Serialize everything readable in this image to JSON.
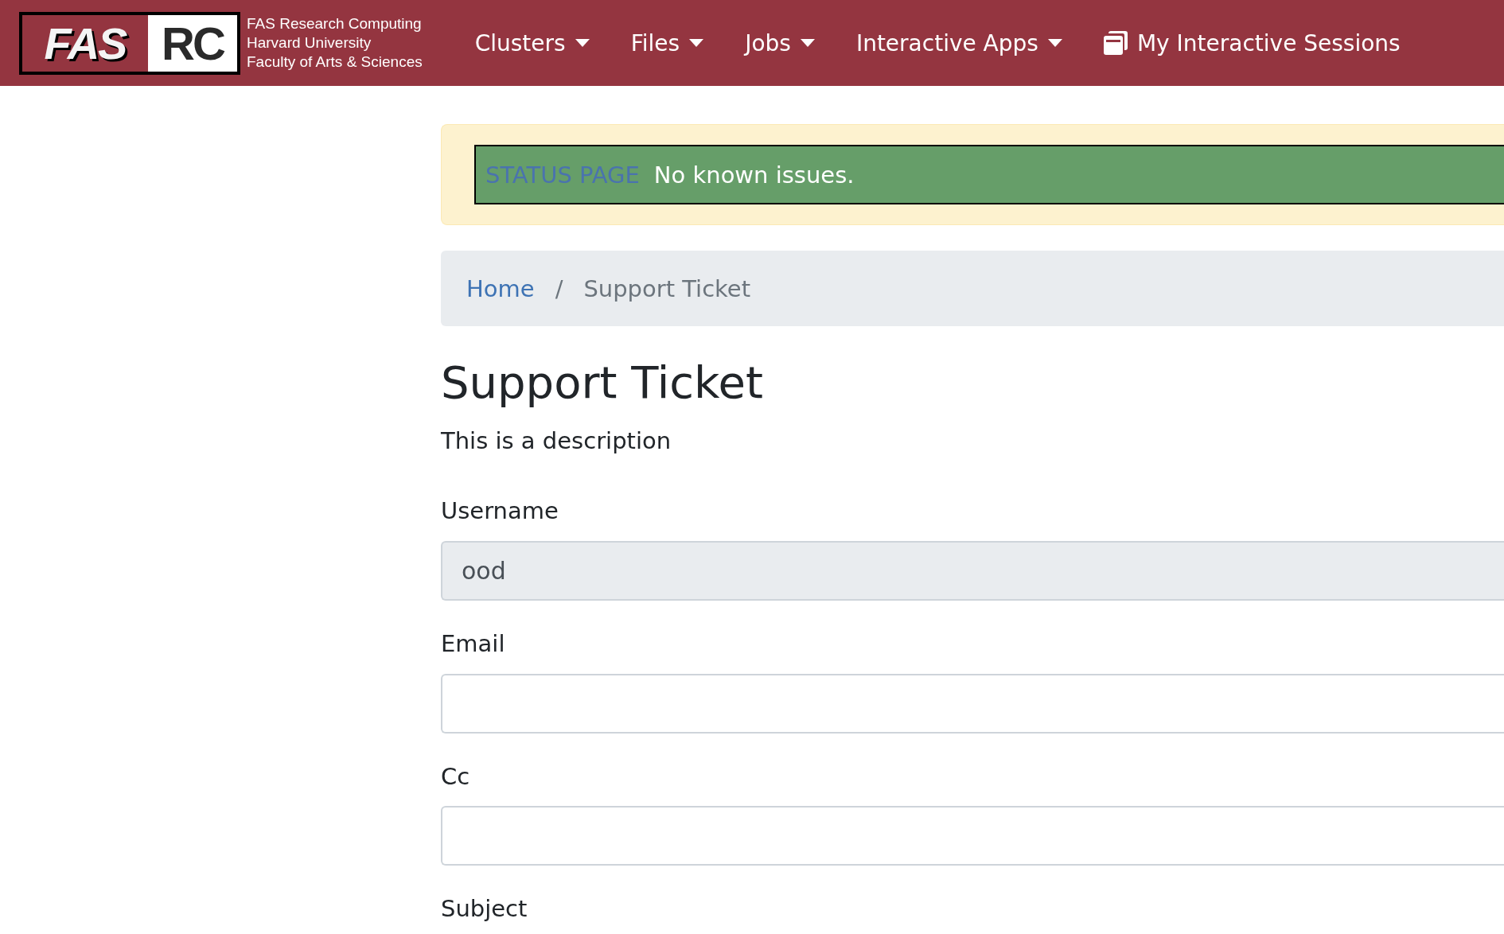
{
  "logo": {
    "mark_left": "FAS",
    "mark_right": "RC",
    "lines": [
      "FAS Research Computing",
      "Harvard University",
      "Faculty of Arts & Sciences"
    ]
  },
  "nav": [
    {
      "label": "Clusters",
      "kind": "dropdown"
    },
    {
      "label": "Files",
      "kind": "dropdown"
    },
    {
      "label": "Jobs",
      "kind": "dropdown"
    },
    {
      "label": "Interactive Apps",
      "kind": "dropdown"
    },
    {
      "label": "My Interactive Sessions",
      "kind": "sessions"
    }
  ],
  "status": {
    "link": "STATUS PAGE",
    "message": "No known issues."
  },
  "breadcrumb": [
    {
      "label": "Home",
      "kind": "link"
    },
    {
      "label": "Support Ticket",
      "kind": "current"
    }
  ],
  "separator": "/",
  "title": "Support Ticket",
  "description": "This is a description",
  "fields": [
    {
      "label": "Username",
      "value": "ood",
      "disabled": true
    },
    {
      "label": "Email",
      "disabled": false
    },
    {
      "label": "Cc",
      "disabled": false
    }
  ],
  "next_label": "Subject"
}
